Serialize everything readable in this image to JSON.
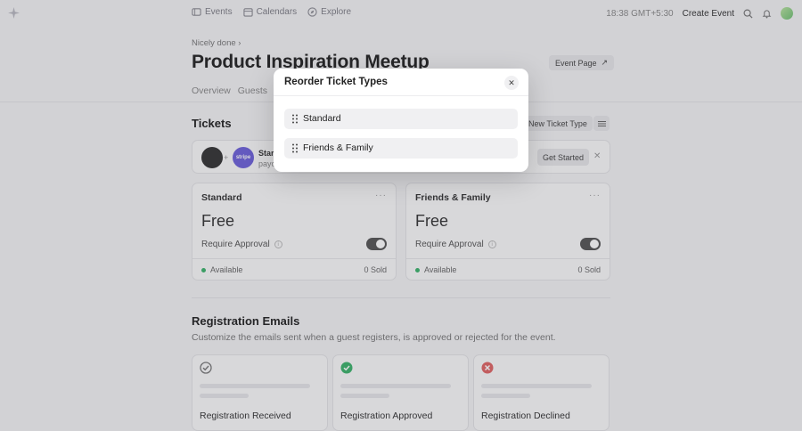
{
  "nav": {
    "events": "Events",
    "calendars": "Calendars",
    "explore": "Explore"
  },
  "topright": {
    "time": "18:38 GMT+5:30",
    "create": "Create Event"
  },
  "header": {
    "breadcrumb": "Nicely done",
    "title": "Product Inspiration Meetup",
    "event_page": "Event Page"
  },
  "tabs": [
    "Overview",
    "Guests",
    "R"
  ],
  "tickets": {
    "heading": "Tickets",
    "new_ticket": "New Ticket Type",
    "stripe": {
      "line1": "Star",
      "line2": "payo",
      "get_started": "Get Started",
      "logo_text": "stripe"
    },
    "cards": [
      {
        "name": "Standard",
        "price": "Free",
        "require": "Require Approval",
        "status": "Available",
        "sold": "0 Sold"
      },
      {
        "name": "Friends & Family",
        "price": "Free",
        "require": "Require Approval",
        "status": "Available",
        "sold": "0 Sold"
      }
    ]
  },
  "emails": {
    "heading": "Registration Emails",
    "subtitle": "Customize the emails sent when a guest registers, is approved or rejected for the event.",
    "cards": [
      {
        "label": "Registration Received"
      },
      {
        "label": "Registration Approved"
      },
      {
        "label": "Registration Declined"
      }
    ]
  },
  "modal": {
    "title": "Reorder Ticket Types",
    "items": [
      "Standard",
      "Friends & Family"
    ]
  },
  "colors": {
    "accent_green": "#3bb36b",
    "declined_red": "#e06464"
  }
}
